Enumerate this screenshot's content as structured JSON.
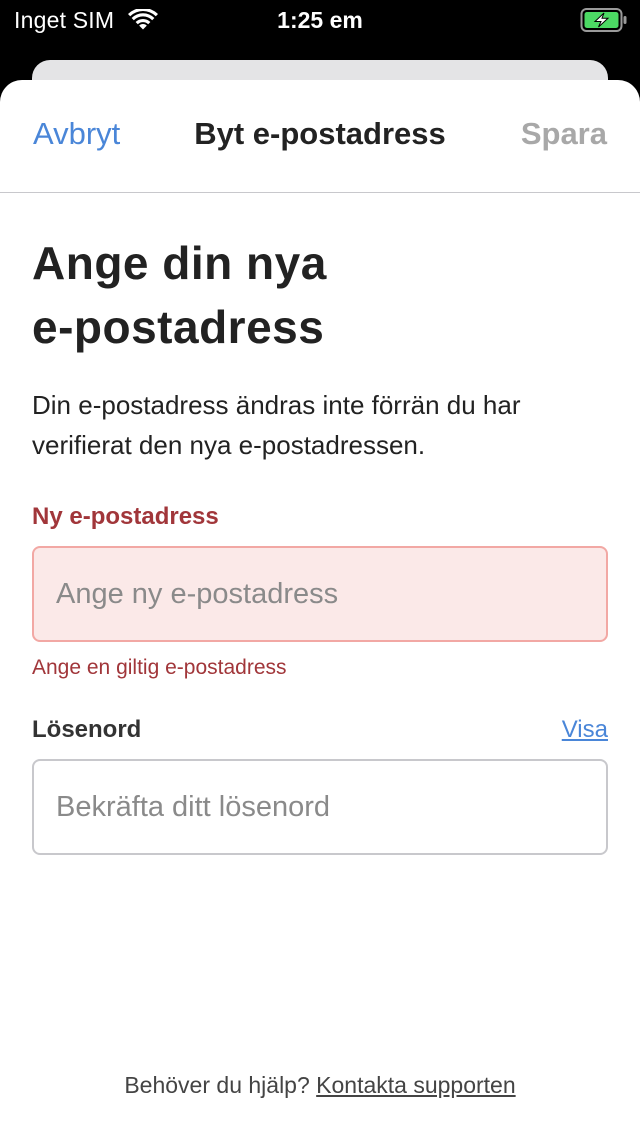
{
  "status_bar": {
    "carrier": "Inget SIM",
    "time": "1:25 em",
    "icons": [
      "wifi-icon",
      "battery-charging-icon"
    ],
    "battery_color": "#4cd964"
  },
  "nav": {
    "cancel_label": "Avbryt",
    "title": "Byt e-postadress",
    "save_label": "Spara"
  },
  "main": {
    "headline_line1": "Ange din nya",
    "headline_line2": "e-postadress",
    "subtitle": "Din e-postadress ändras inte förrän du har verifierat den nya e-postadressen."
  },
  "email_field": {
    "label": "Ny e-postadress",
    "value": "",
    "placeholder": "Ange ny e-postadress",
    "error": "Ange en giltig e-postadress"
  },
  "password_field": {
    "label": "Lösenord",
    "show_label": "Visa",
    "value": "",
    "placeholder": "Bekräfta ditt lösenord"
  },
  "footer": {
    "help_text": "Behöver du hjälp?",
    "support_link": "Kontakta supporten"
  },
  "colors": {
    "accent": "#4a86d8",
    "error": "#a1363a",
    "error_background": "#fbe9e8",
    "error_border": "#f2a8a4",
    "disabled": "#a8a8a8"
  }
}
